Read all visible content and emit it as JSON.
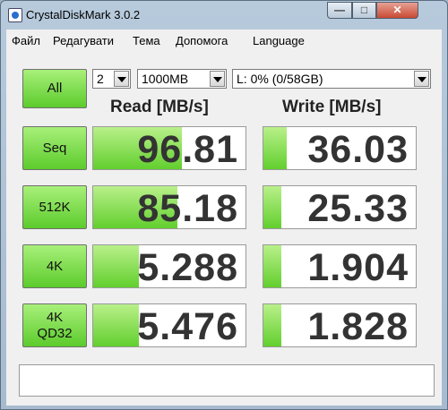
{
  "window": {
    "title": "CrystalDiskMark 3.0.2"
  },
  "menu": [
    "Файл",
    "Редагувати",
    "Тема",
    "Допомога",
    "Language"
  ],
  "controls": {
    "all_label": "All",
    "count": "2",
    "size": "1000MB",
    "drive": "L: 0% (0/58GB)"
  },
  "headers": {
    "read": "Read [MB/s]",
    "write": "Write [MB/s]"
  },
  "tests": [
    {
      "label": "Seq",
      "read": "96.81",
      "write": "36.03"
    },
    {
      "label": "512K",
      "read": "85.18",
      "write": "25.33"
    },
    {
      "label": "4K",
      "read": "5.288",
      "write": "1.904"
    },
    {
      "label": "4K\nQD32",
      "read": "5.476",
      "write": "1.828"
    }
  ],
  "bar_fill": [
    {
      "read": 0.58,
      "write": 0.15
    },
    {
      "read": 0.55,
      "write": 0.12
    },
    {
      "read": 0.3,
      "write": 0.12
    },
    {
      "read": 0.3,
      "write": 0.12
    }
  ],
  "colors": {
    "accent_green": "#5ccb2c",
    "bar_green": "#62cf2e"
  },
  "status": ""
}
